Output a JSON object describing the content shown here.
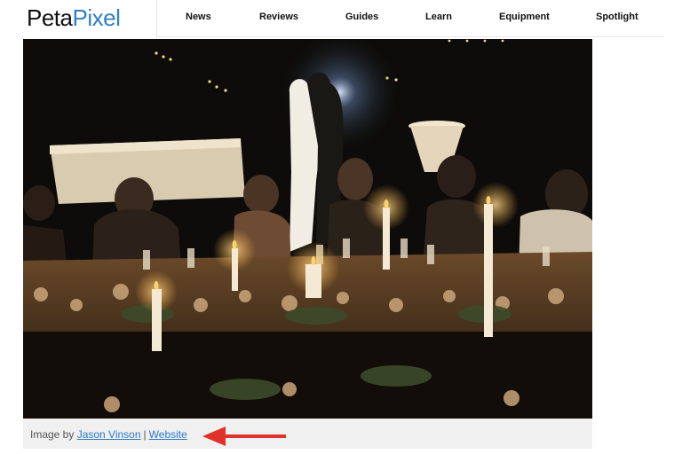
{
  "brand": {
    "logo_part1": "Peta",
    "logo_part2": "Pixel"
  },
  "nav": {
    "items": [
      {
        "label": "News"
      },
      {
        "label": "Reviews"
      },
      {
        "label": "Guides"
      },
      {
        "label": "Learn"
      },
      {
        "label": "Equipment"
      },
      {
        "label": "Spotlight"
      }
    ]
  },
  "photo": {
    "subject": "couple dancing behind candlelit dinner table at night"
  },
  "caption": {
    "prefix": "Image by",
    "author_link": "Jason Vinson",
    "separator": "|",
    "website_link": "Website"
  },
  "colors": {
    "brand_blue": "#2f80c8",
    "link": "#2f78c8",
    "arrow": "#e0312a"
  }
}
